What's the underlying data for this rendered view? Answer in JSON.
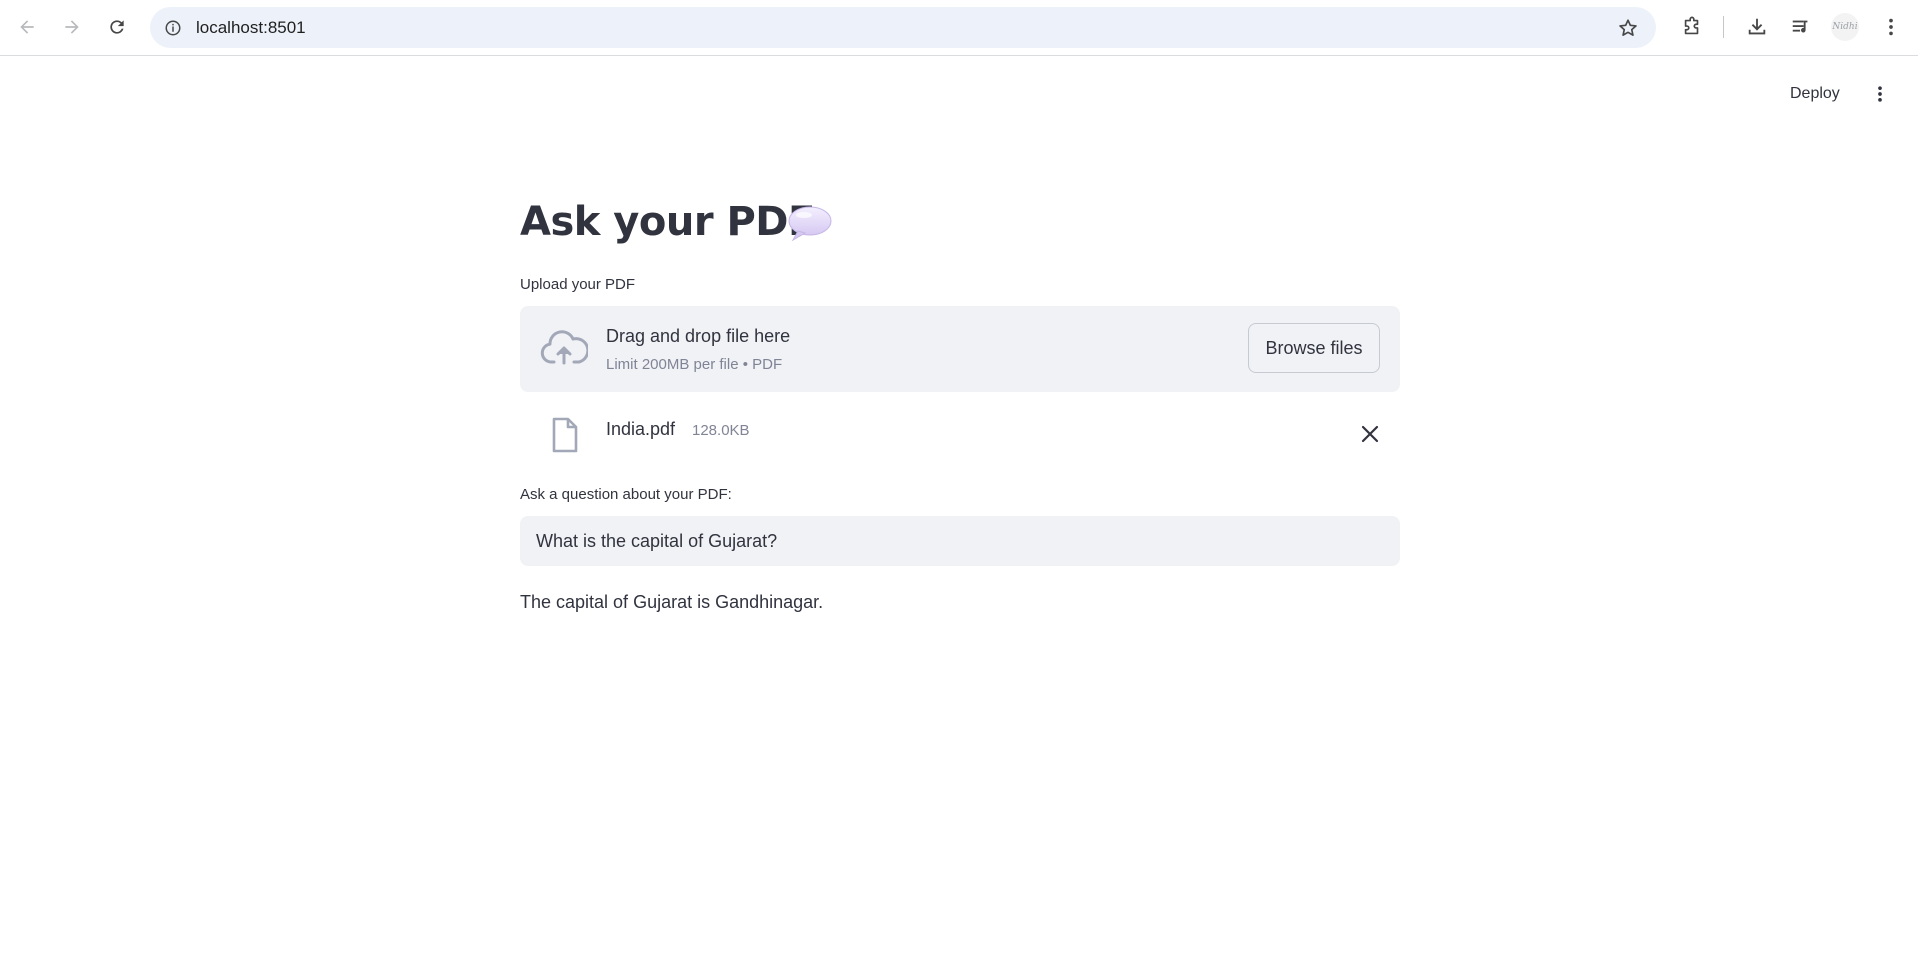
{
  "browser": {
    "url": "localhost:8501",
    "profile_label": "Nidhi"
  },
  "header": {
    "deploy_label": "Deploy"
  },
  "main": {
    "title": "Ask your PDF",
    "title_icon": "speech-balloon-icon",
    "upload": {
      "label": "Upload your PDF",
      "drop_title": "Drag and drop file here",
      "drop_subtitle": "Limit 200MB per file • PDF",
      "browse_label": "Browse files",
      "file": {
        "name": "India.pdf",
        "size": "128.0KB"
      }
    },
    "question": {
      "label": "Ask a question about your PDF:",
      "value": "What is the capital of Gujarat?"
    },
    "answer": "The capital of Gujarat is Gandhinagar."
  },
  "colors": {
    "text": "#31333f",
    "muted": "#808495",
    "panel": "#f0f2f6",
    "omnibox": "#edf2fa"
  }
}
